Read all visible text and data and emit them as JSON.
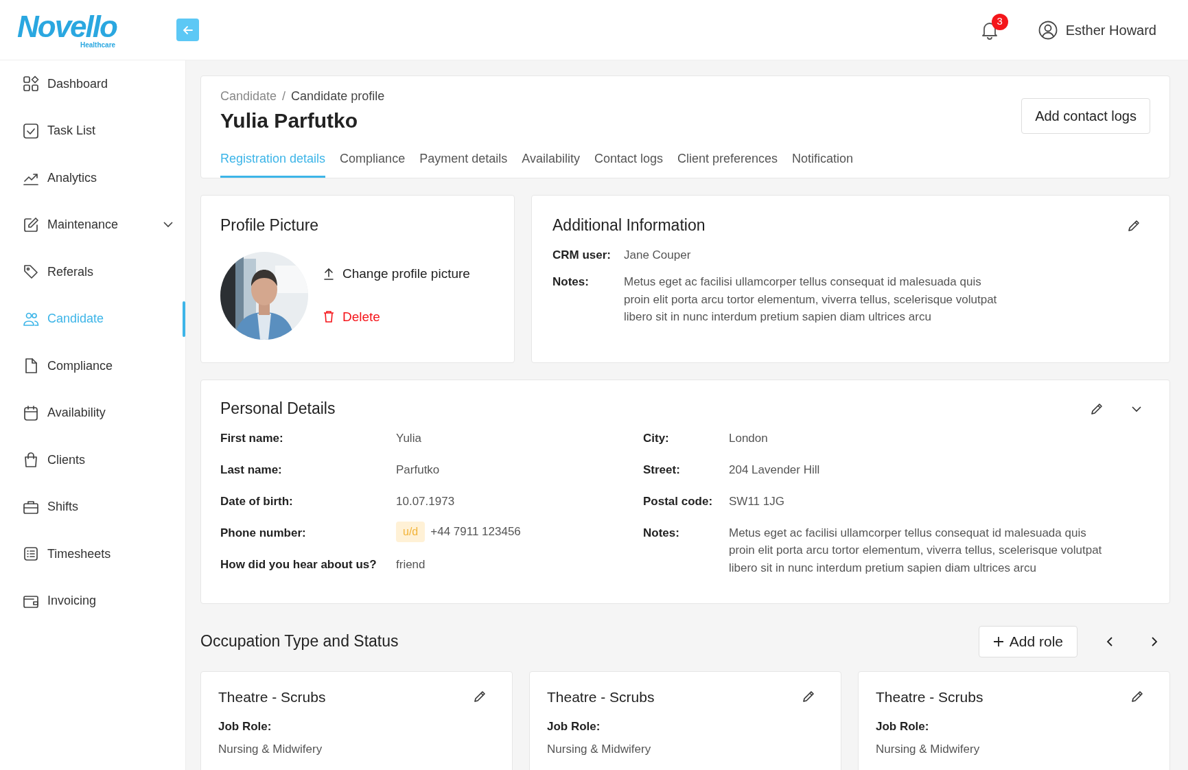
{
  "logo": {
    "name": "Novello",
    "tagline": "Healthcare"
  },
  "header": {
    "notification_count": "3",
    "user_name": "Esther Howard"
  },
  "sidebar": {
    "items": [
      {
        "label": "Dashboard",
        "kind": "link",
        "selected": false
      },
      {
        "label": "Task List",
        "kind": "link",
        "selected": false
      },
      {
        "label": "Analytics",
        "kind": "link",
        "selected": false
      },
      {
        "label": "Maintenance",
        "kind": "group",
        "selected": false
      },
      {
        "label": "Referals",
        "kind": "link",
        "selected": false
      },
      {
        "label": "Candidate",
        "kind": "link",
        "selected": true
      },
      {
        "label": "Compliance",
        "kind": "link",
        "selected": false
      },
      {
        "label": "Availability",
        "kind": "link",
        "selected": false
      },
      {
        "label": "Clients",
        "kind": "link",
        "selected": false
      },
      {
        "label": "Shifts",
        "kind": "link",
        "selected": false
      },
      {
        "label": "Timesheets",
        "kind": "link",
        "selected": false
      },
      {
        "label": "Invoicing",
        "kind": "link",
        "selected": false
      }
    ]
  },
  "breadcrumbs": [
    "Candidate",
    "Candidate profile"
  ],
  "breadcrumb_separator": "/",
  "page_title": "Yulia Parfutko",
  "add_contact_logs": "Add contact logs",
  "tabs": [
    {
      "label": "Registration details",
      "selected": true
    },
    {
      "label": "Compliance",
      "selected": false
    },
    {
      "label": "Payment details",
      "selected": false
    },
    {
      "label": "Availability",
      "selected": false
    },
    {
      "label": "Contact logs",
      "selected": false
    },
    {
      "label": "Client preferences",
      "selected": false
    },
    {
      "label": "Notification",
      "selected": false
    }
  ],
  "profile_picture": {
    "title": "Profile Picture",
    "change_label": "Change profile picture",
    "delete_label": "Delete"
  },
  "additional_information": {
    "title": "Additional Information",
    "fields": [
      {
        "label": "CRM user:",
        "value": "Jane Couper"
      },
      {
        "label": "Notes:",
        "value": "Metus eget ac facilisi ullamcorper tellus consequat id malesuada quis proin elit porta arcu tortor elementum, viverra tellus, scelerisque volutpat libero sit in nunc interdum pretium sapien diam ultrices arcu"
      }
    ]
  },
  "personal_details": {
    "title": "Personal Details",
    "left_fields": [
      {
        "label": "First name:",
        "value": "Yulia"
      },
      {
        "label": "Last name:",
        "value": "Parfutko"
      },
      {
        "label": "Date of birth:",
        "value": "10.07.1973"
      },
      {
        "label": "Phone number:",
        "value": "+44 7911 123456",
        "tag": "u/d"
      },
      {
        "label": "How did you hear about us?",
        "value": "friend"
      }
    ],
    "right_fields": [
      {
        "label": "City:",
        "value": "London"
      },
      {
        "label": "Street:",
        "value": "204 Lavender Hill"
      },
      {
        "label": "Postal code:",
        "value": "SW11 1JG"
      },
      {
        "label": "Notes:",
        "value": "Metus eget ac facilisi ullamcorper tellus consequat id malesuada quis proin elit porta arcu tortor elementum, viverra tellus, scelerisque volutpat libero sit in nunc interdum pretium sapien diam ultrices arcu"
      }
    ]
  },
  "occupation": {
    "title": "Occupation Type and Status",
    "add_role_label": "Add role",
    "cards": [
      {
        "title": "Theatre - Scrubs",
        "fields": [
          {
            "label": "Job Role:",
            "value": "Nursing & Midwifery"
          }
        ]
      },
      {
        "title": "Theatre - Scrubs",
        "fields": [
          {
            "label": "Job Role:",
            "value": "Nursing & Midwifery"
          }
        ]
      },
      {
        "title": "Theatre - Scrubs",
        "fields": [
          {
            "label": "Job Role:",
            "value": "Nursing & Midwifery"
          }
        ]
      }
    ]
  }
}
